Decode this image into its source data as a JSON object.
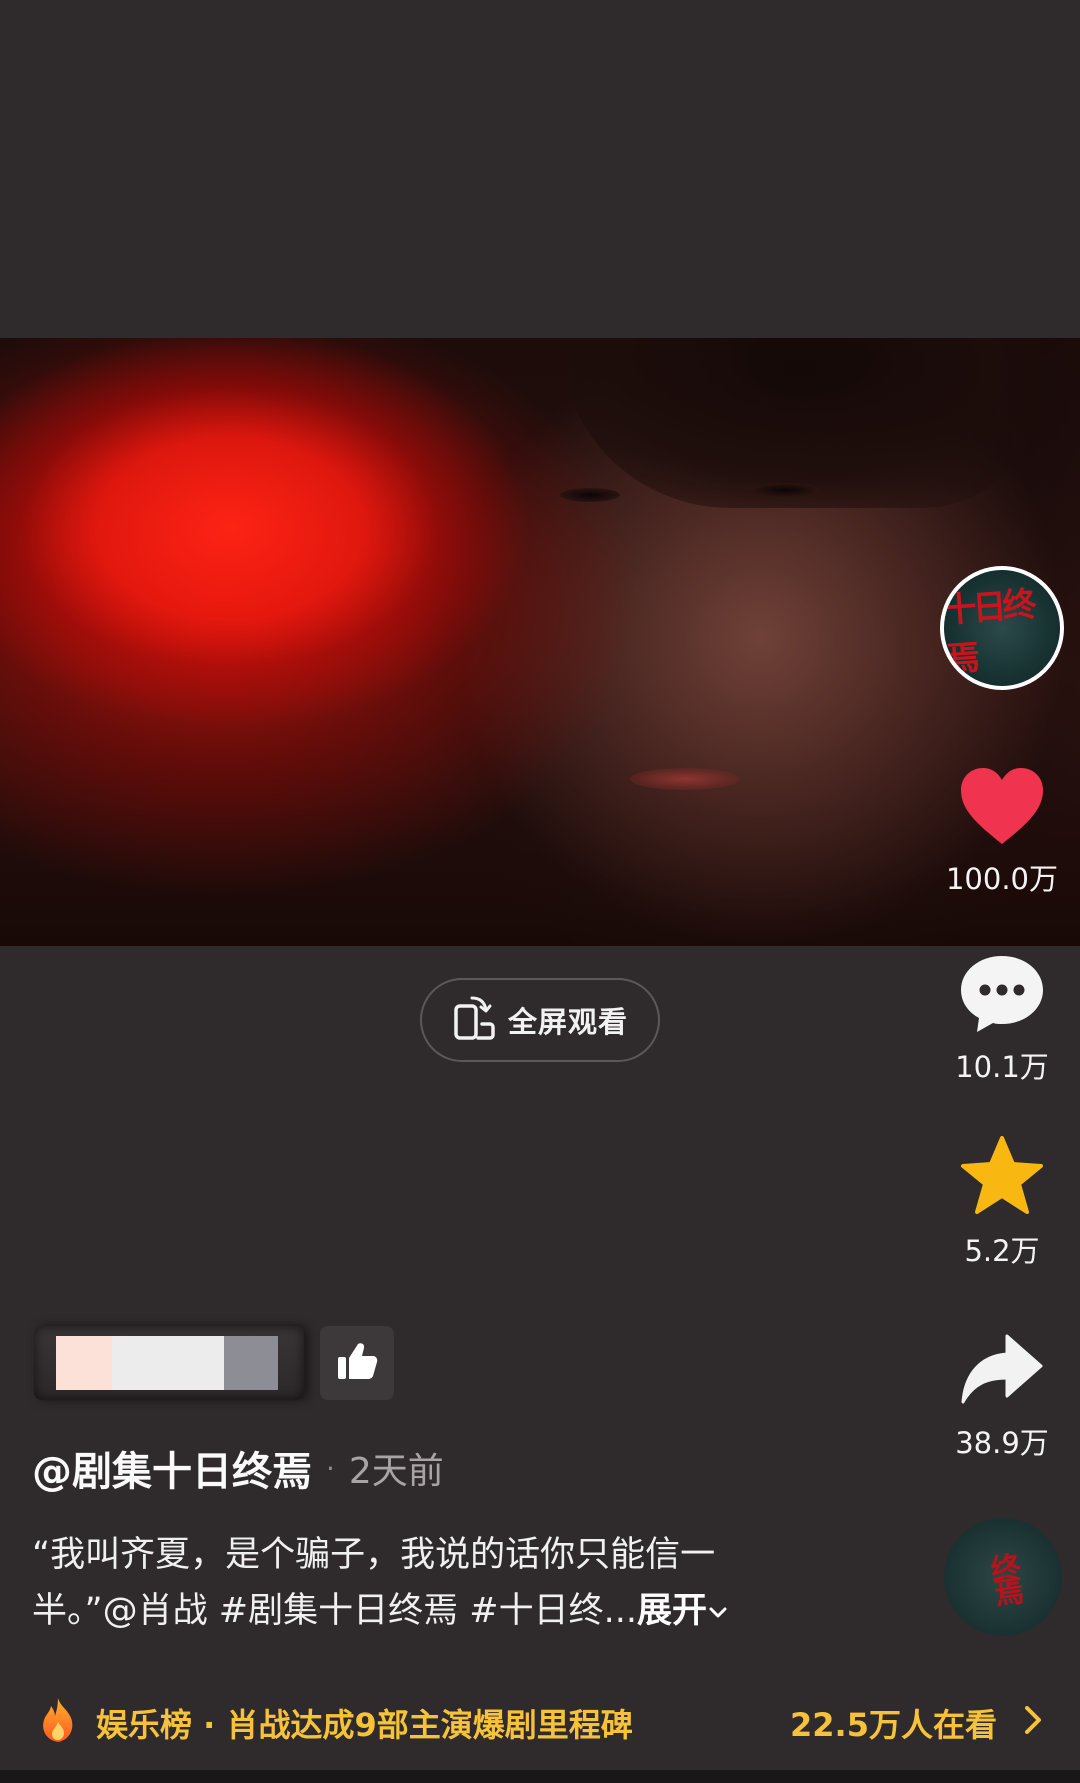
{
  "video": {
    "fullscreen_label": "全屏观看"
  },
  "profile": {
    "avatar_text": "十日终焉"
  },
  "actions": {
    "likes": "100.0万",
    "comments": "10.1万",
    "favorites": "5.2万",
    "shares": "38.9万"
  },
  "post": {
    "author": "@剧集十日终焉",
    "separator": "·",
    "time": "2天前",
    "caption_line1": "“我叫齐夏，是个骗子，我说的话你只能信一",
    "caption_line2_prefix": "半。”",
    "mention": "@肖战",
    "hashtag1": "#剧集十日终焉",
    "hashtag2": "#十日终...",
    "expand_label": "展开"
  },
  "trending": {
    "text": "娱乐榜 · 肖战达成9部主演爆剧里程碑",
    "viewers": "22.5万人在看"
  },
  "music": {
    "disc_text": "终焉"
  },
  "colors": {
    "background": "#2f2a2c",
    "like_red": "#f0344f",
    "favorite_yellow": "#f9b712",
    "trend_gold": "#f5c23a"
  }
}
